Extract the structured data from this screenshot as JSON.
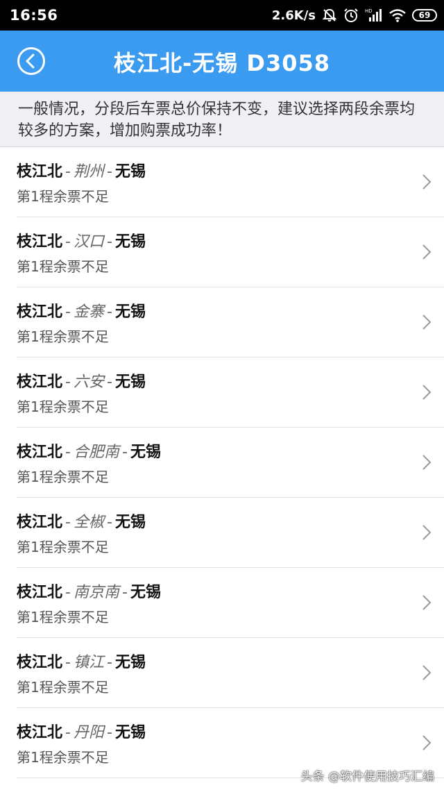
{
  "status_bar": {
    "time": "16:56",
    "net_speed": "2.6K/s",
    "battery": "69",
    "icons": [
      "mute-bell-icon",
      "alarm-icon",
      "signal-icon",
      "wifi-icon",
      "battery-icon"
    ]
  },
  "header": {
    "title": "枝江北-无锡 D3058",
    "back_icon": "back-arrow-circle-icon",
    "background_color": "#3a9bf0"
  },
  "notice": {
    "text": "一般情况，分段后车票总价保持不变，建议选择两段余票均较多的方案，增加购票成功率！"
  },
  "routes": [
    {
      "from": "枝江北",
      "sep1": "-",
      "via": "荆州",
      "sep2": "-",
      "to": "无锡",
      "status": "第1程余票不足"
    },
    {
      "from": "枝江北",
      "sep1": "-",
      "via": "汉口",
      "sep2": "-",
      "to": "无锡",
      "status": "第1程余票不足"
    },
    {
      "from": "枝江北",
      "sep1": "-",
      "via": "金寨",
      "sep2": "-",
      "to": "无锡",
      "status": "第1程余票不足"
    },
    {
      "from": "枝江北",
      "sep1": "-",
      "via": "六安",
      "sep2": "-",
      "to": "无锡",
      "status": "第1程余票不足"
    },
    {
      "from": "枝江北",
      "sep1": "-",
      "via": "合肥南",
      "sep2": "-",
      "to": "无锡",
      "status": "第1程余票不足"
    },
    {
      "from": "枝江北",
      "sep1": "-",
      "via": "全椒",
      "sep2": "-",
      "to": "无锡",
      "status": "第1程余票不足"
    },
    {
      "from": "枝江北",
      "sep1": "-",
      "via": "南京南",
      "sep2": "-",
      "to": "无锡",
      "status": "第1程余票不足"
    },
    {
      "from": "枝江北",
      "sep1": "-",
      "via": "镇江",
      "sep2": "-",
      "to": "无锡",
      "status": "第1程余票不足"
    },
    {
      "from": "枝江北",
      "sep1": "-",
      "via": "丹阳",
      "sep2": "-",
      "to": "无锡",
      "status": "第1程余票不足"
    }
  ],
  "watermark": {
    "text": "头条 @软件使用技巧汇编"
  }
}
